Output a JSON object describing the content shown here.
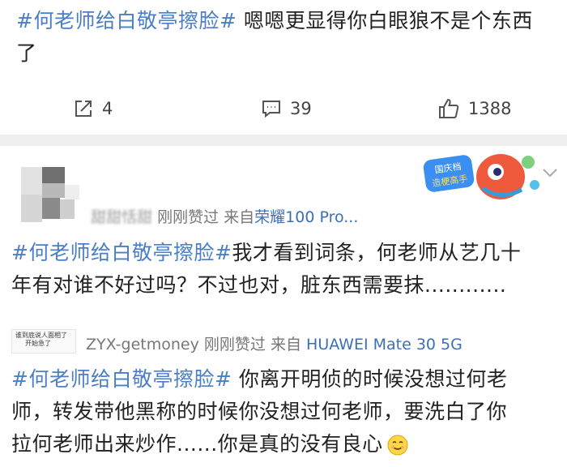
{
  "post": {
    "hashtag": "#何老师给白敬亭擦脸#",
    "text_line1": " 嗯嗯更显得你白眼狼不是个东西",
    "text_line2": "了"
  },
  "actions": {
    "repost_count": "4",
    "comment_count": "39",
    "like_count": "1388"
  },
  "comments": [
    {
      "author": "甜甜恬甜",
      "time": "刚刚赞过",
      "source_prefix": "来自",
      "device": "荣耀100 Pro...",
      "hashtag": "#何老师给白敬亭擦脸#",
      "line1": "我才看到词条，何老师从艺几十",
      "line2": "年有对谁不好过吗？不过也对，脏东西需要抹............",
      "sticker_text": "国庆档 造梗高手"
    },
    {
      "author": "ZYX-getmoney",
      "time": "刚刚赞过",
      "source_prefix": "来自",
      "device": "HUAWEI Mate 30 5G",
      "avatar_text_1": "谁到底说人面相了",
      "avatar_text_2": "开始急了",
      "hashtag": "#何老师给白敬亭擦脸#",
      "line1": " 你离开明侦的时候没想过何老",
      "line2": "师，转发带他黑称的时候你没想过何老师，要洗白了你",
      "line3": "拉何老师出来炒作......你是真的没有良心"
    }
  ],
  "icons": {
    "repost": "share-square-icon",
    "comment": "comment-bubble-icon",
    "like": "thumbs-up-icon",
    "more": "chevron-down-icon",
    "emoji": "smile-emoji-icon"
  },
  "colors": {
    "hashtag": "#4a7fc7",
    "device_link": "#3d6fb6",
    "divider": "#f0f0f0"
  }
}
